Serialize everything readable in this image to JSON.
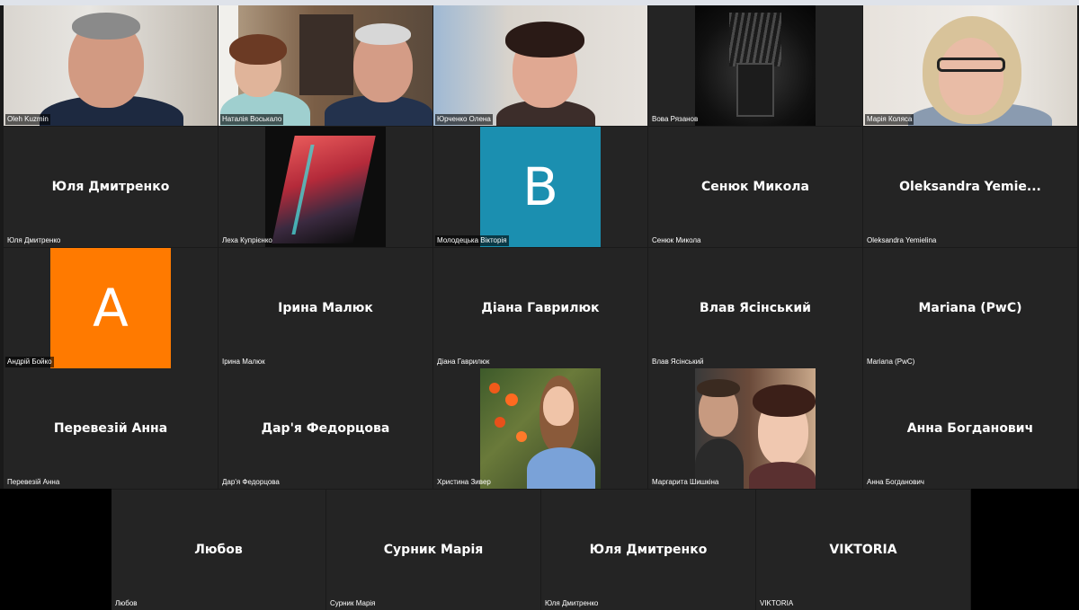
{
  "colors": {
    "tile_bg": "#242424",
    "avatar_blue": "#1b8fb0",
    "avatar_orange": "#ff7a00"
  },
  "participants": [
    {
      "label": "Oleh Kuzmin",
      "type": "video",
      "icon": "video-feed"
    },
    {
      "label": "Наталія Воськало",
      "type": "video",
      "icon": "video-feed"
    },
    {
      "label": "Юрченко Олена",
      "type": "video",
      "icon": "video-feed"
    },
    {
      "label": "Вова Рязанов",
      "type": "image",
      "icon": "iron-throne-image"
    },
    {
      "label": "Марія Коляса",
      "type": "video",
      "icon": "video-feed"
    },
    {
      "label": "Юля Дмитренко",
      "display": "Юля Дмитренко",
      "type": "name"
    },
    {
      "label": "Леха Купрієнко",
      "type": "image",
      "icon": "abstract-art-image"
    },
    {
      "label": "Молодецька Вікторія",
      "type": "avatar",
      "letter": "B"
    },
    {
      "label": "Сенюк Микола",
      "display": "Сенюк Микола",
      "type": "name"
    },
    {
      "label": "Oleksandra Yemielina",
      "display": "Oleksandra  Yemie...",
      "type": "name"
    },
    {
      "label": "Андрій Бойко",
      "type": "avatar",
      "letter": "A"
    },
    {
      "label": "Ірина Малюк",
      "display": "Ірина Малюк",
      "type": "name"
    },
    {
      "label": "Діана Гаврилюк",
      "display": "Діана Гаврилюк",
      "type": "name"
    },
    {
      "label": "Влав Ясінський",
      "display": "Влав Ясінський",
      "type": "name"
    },
    {
      "label": "Mariana (PwC)",
      "display": "Mariana (PwC)",
      "type": "name"
    },
    {
      "label": "Перевезій Анна",
      "display": "Перевезій Анна",
      "type": "name"
    },
    {
      "label": "Дар'я Федорцова",
      "display": "Дар'я Федорцова",
      "type": "name"
    },
    {
      "label": "Христина Зивер",
      "type": "image",
      "icon": "flower-portrait-image"
    },
    {
      "label": "Маргарита Шишкіна",
      "type": "image",
      "icon": "couple-portrait-image"
    },
    {
      "label": "Анна Богданович",
      "display": "Анна Богданович",
      "type": "name"
    },
    {
      "label": "Любов",
      "display": "Любов",
      "type": "name"
    },
    {
      "label": "Сурник Марія",
      "display": "Сурник Марія",
      "type": "name"
    },
    {
      "label": "Юля Дмитренко",
      "display": "Юля Дмитренко",
      "type": "name"
    },
    {
      "label": "VIKTORIA",
      "display": "VIKTORIA",
      "type": "name"
    }
  ]
}
